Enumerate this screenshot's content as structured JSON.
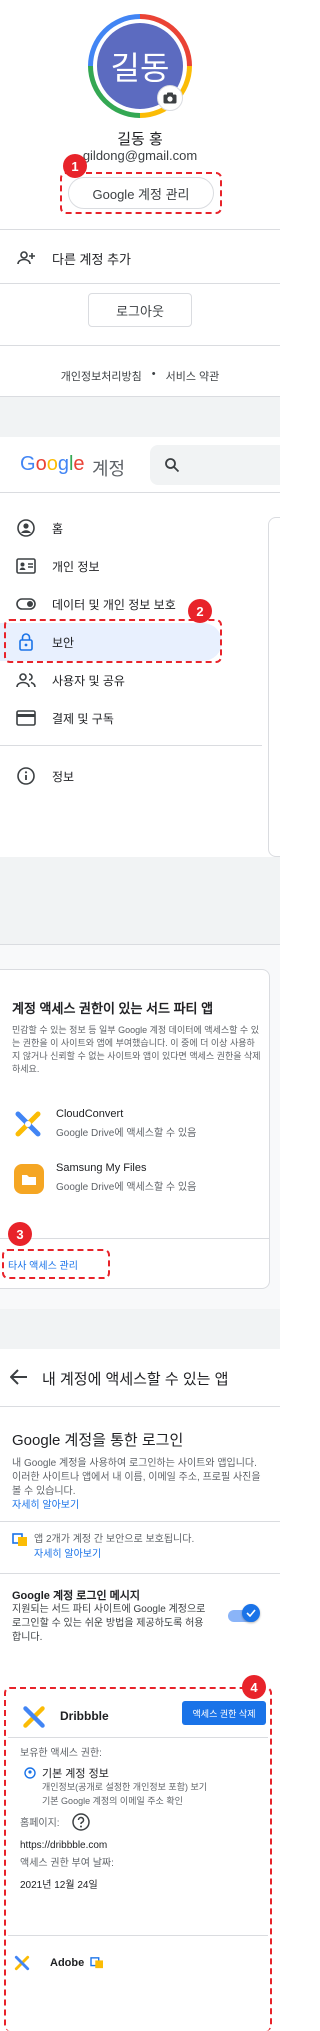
{
  "account": {
    "avatar_text": "길동",
    "name": "길동 홍",
    "email": "gildong@gmail.com",
    "manage_button": "Google 계정 관리",
    "add_account": "다른 계정 추가",
    "logout": "로그아웃",
    "privacy": "개인정보처리방침",
    "dot": "•",
    "terms": "서비스 약관"
  },
  "badges": {
    "b1": "1",
    "b2": "2",
    "b3": "3",
    "b4": "4"
  },
  "nav": {
    "logo_letters": [
      {
        "ch": "G",
        "color": "#4285f4"
      },
      {
        "ch": "o",
        "color": "#ea4335"
      },
      {
        "ch": "o",
        "color": "#fbbc05"
      },
      {
        "ch": "g",
        "color": "#4285f4"
      },
      {
        "ch": "l",
        "color": "#34a853"
      },
      {
        "ch": "e",
        "color": "#ea4335"
      }
    ],
    "product": "계정",
    "items": [
      {
        "label": "홈",
        "icon": "home-icon"
      },
      {
        "label": "개인 정보",
        "icon": "id-card-icon"
      },
      {
        "label": "데이터 및 개인 정보 보호",
        "icon": "toggle-icon"
      },
      {
        "label": "보안",
        "icon": "lock-icon"
      },
      {
        "label": "사용자 및 공유",
        "icon": "people-icon"
      },
      {
        "label": "결제 및 구독",
        "icon": "credit-card-icon"
      },
      {
        "label": "정보",
        "icon": "info-icon"
      }
    ]
  },
  "third_party": {
    "title": "계정 액세스 권한이 있는 서드 파티 앱",
    "desc": "민감할 수 있는 정보 등 일부 Google 계정 데이터에 액세스할 수 있는 권한을 이 사이트와 앱에 부여했습니다. 이 중에 더 이상 사용하지 않거나 신뢰할 수 없는 사이트와 앱이 있다면 액세스 권한을 삭제하세요.",
    "apps": [
      {
        "name": "CloudConvert",
        "detail": "Google Drive에 액세스할 수 있음"
      },
      {
        "name": "Samsung My Files",
        "detail": "Google Drive에 액세스할 수 있음"
      }
    ],
    "manage_link": "타사 액세스 관리"
  },
  "apps_page": {
    "title": "내 계정에 액세스할 수 있는 앱",
    "section_title": "Google 계정을 통한 로그인",
    "section_desc": "내 Google 계정을 사용하여 로그인하는 사이트와 앱입니다. 이러한 사이트나 앱에서 내 이름, 이메일 주소, 프로필 사진을 볼 수 있습니다.",
    "learn_more": "자세히 알아보기",
    "protected_text": "앱 2개가 계정 간 보안으로 보호됩니다.",
    "protected_learn": "자세히 알아보기",
    "msg_title": "Google 계정 로그인 메시지",
    "msg_desc": "지원되는 서드 파티 사이트에 Google 계정으로 로그인할 수 있는 쉬운 방법을 제공하도록 허용합니다.",
    "toggle_on": true,
    "dribbble": {
      "name": "Dribbble",
      "remove_button": "액세스 권한 삭제",
      "access_label": "보유한 액세스 권한:",
      "basic_info": "기본 계정 정보",
      "basic_info_line1": "개인정보(공개로 설정한 개인정보 포함) 보기",
      "basic_info_line2": "기본 Google 계정의 이메일 주소 확인",
      "homepage_label": "홈페이지:",
      "homepage_url": "https://dribbble.com",
      "granted_label": "액세스 권한 부여 날짜:",
      "granted_date": "2021년 12월 24일"
    },
    "adobe": {
      "name": "Adobe"
    }
  },
  "colors": {
    "accent": "#1a73e8",
    "annotation": "#e8232a",
    "selected_bg": "#e8f0fe"
  }
}
